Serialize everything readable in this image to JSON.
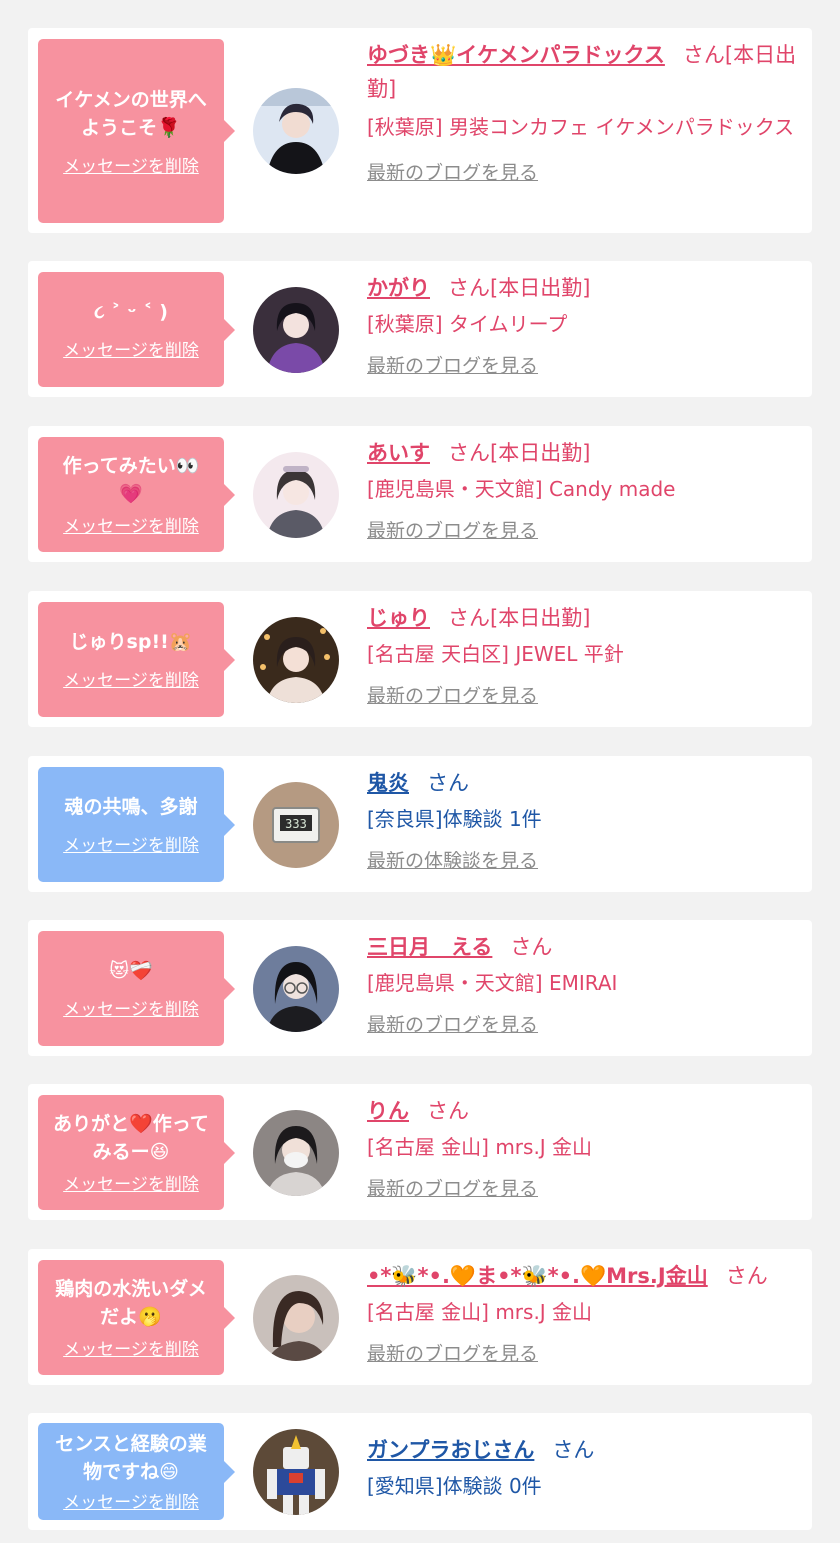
{
  "delete_label": "メッセージを削除",
  "blog_label": "最新のブログを見る",
  "report_label": "最新の体験談を見る",
  "colors": {
    "pink_bubble": "#f7929f",
    "blue_bubble": "#8ab8f7",
    "pink_text": "#e0456a",
    "blue_text": "#1f57a6"
  },
  "items": [
    {
      "message_lines": [
        "イケメンの世界へ",
        "ようこそ🌹"
      ],
      "name": "ゆづき👑イケメンパラドックス",
      "honorific": "さん[本日出勤]",
      "shop": "[秋葉原] 男装コンカフェ イケメンパラドックス",
      "link": "最新のブログを見る",
      "type": "pink",
      "avatar": "man-dark-icon"
    },
    {
      "message_lines": [
        "૮ ˃ ᵕ ˂ )"
      ],
      "name": "かがり",
      "honorific": "さん[本日出勤]",
      "shop": "[秋葉原] タイムリープ",
      "link": "最新のブログを見る",
      "type": "pink",
      "avatar": "girl-purple-icon"
    },
    {
      "message_lines": [
        "作ってみたい👀",
        "💗"
      ],
      "name": "あいす",
      "honorific": "さん[本日出勤]",
      "shop": "[鹿児島県・天文館] Candy made",
      "link": "最新のブログを見る",
      "type": "pink",
      "avatar": "girl-light-icon"
    },
    {
      "message_lines": [
        "じゅりsp!!🐹"
      ],
      "name": "じゅり",
      "honorific": "さん[本日出勤]",
      "shop": "[名古屋 天白区] JEWEL 平針",
      "link": "最新のブログを見る",
      "type": "pink",
      "avatar": "girl-lights-icon"
    },
    {
      "message_lines": [
        "魂の共鳴、多謝"
      ],
      "name": "鬼炎",
      "honorific": "さん",
      "shop": "[奈良県]体験談 1件",
      "link": "最新の体験談を見る",
      "type": "blue",
      "avatar": "clock-icon"
    },
    {
      "message_lines": [
        "😻❤️‍🩹"
      ],
      "name": "三日月　える",
      "honorific": "さん",
      "shop": "[鹿児島県・天文館] EMIRAI",
      "link": "最新のブログを見る",
      "type": "pink",
      "avatar": "girl-glasses-icon"
    },
    {
      "message_lines": [
        "ありがと❤️作って",
        "みるー😆"
      ],
      "name": "りん",
      "honorific": "さん",
      "shop": "[名古屋 金山] mrs.J 金山",
      "link": "最新のブログを見る",
      "type": "pink",
      "avatar": "girl-mask-icon"
    },
    {
      "message_lines": [
        "鶏肉の水洗いダメ",
        "だよ🫢"
      ],
      "name": "•*🐝*•.🧡ま•*🐝*•.🧡Mrs.J金山",
      "honorific": "さん",
      "shop": "[名古屋 金山] mrs.J 金山",
      "link": "最新のブログを見る",
      "type": "pink",
      "avatar": "woman-icon"
    },
    {
      "message_lines": [
        "センスと経験の業",
        "物ですね😄"
      ],
      "name": "ガンプラおじさん",
      "honorific": "さん",
      "shop": "[愛知県]体験談 0件",
      "link": "最新の体験談を見る",
      "type": "blue",
      "avatar": "robot-icon"
    }
  ]
}
